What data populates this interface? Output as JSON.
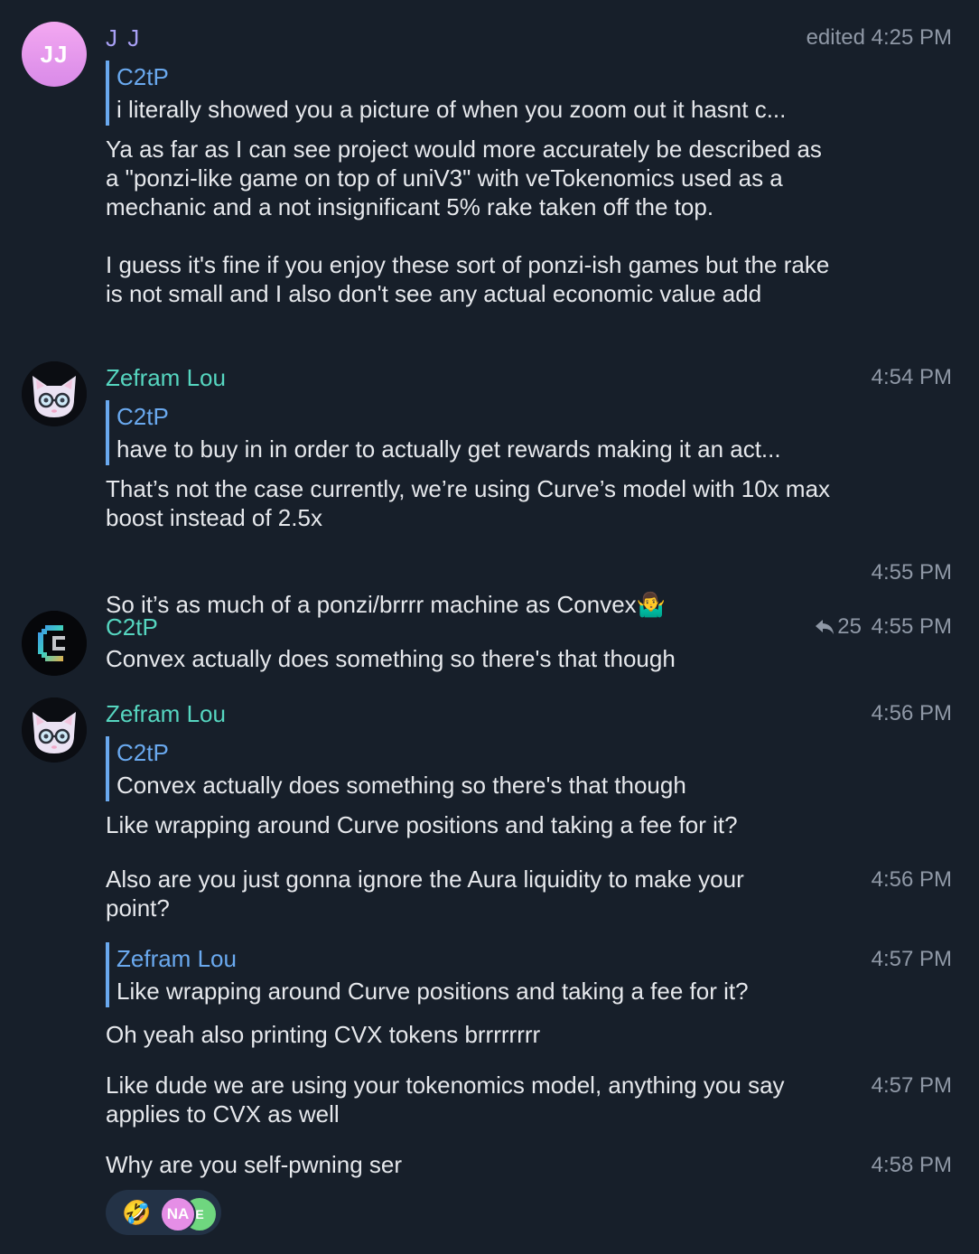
{
  "messages": {
    "m1": {
      "avatar_initials": "JJ",
      "sender": "J J",
      "time": "edited 4:25 PM",
      "reply_name": "C2tP",
      "reply_text": "i literally showed you a picture of when you zoom out it hasnt c...",
      "text": "Ya as far as I can see project would more accurately be described as a \"ponzi-like game on top of uniV3\" with veTokenomics used as a mechanic and a not insignificant 5% rake taken off the top.\n\nI guess it's fine if you enjoy these sort of ponzi-ish games but the rake is not small and I also don't see any actual economic value add"
    },
    "m2": {
      "sender": "Zefram Lou",
      "time": "4:54 PM",
      "reply_name": "C2tP",
      "reply_text": "have to buy in in order to actually get rewards making it an act...",
      "text": "That’s not the case currently, we’re using Curve’s model with 10x max boost instead of 2.5x"
    },
    "m3": {
      "text": "So it’s as much of a ponzi/brrrr machine as Convex",
      "emoji": "🤷‍♂️",
      "time": "4:55 PM"
    },
    "m4": {
      "sender": "C2tP",
      "reply_count": "25",
      "time": "4:55 PM",
      "text": "Convex actually does something so there's that though"
    },
    "m5": {
      "sender": "Zefram Lou",
      "time": "4:56 PM",
      "reply_name": "C2tP",
      "reply_text": "Convex actually does something so there's that though",
      "text": "Like wrapping around Curve positions and taking a fee for it?"
    },
    "m6": {
      "text": "Also are you just gonna ignore the Aura liquidity to make your point?",
      "time": "4:56 PM"
    },
    "m7": {
      "reply_name": "Zefram Lou",
      "reply_text": "Like wrapping around Curve positions and taking a fee for it?",
      "time": "4:57 PM",
      "text": "Oh yeah also printing CVX tokens brrrrrrrr"
    },
    "m8": {
      "text": "Like dude we are using your tokenomics model, anything you say applies to CVX as well",
      "time": "4:57 PM"
    },
    "m9": {
      "text": "Why are you self-pwning ser",
      "time": "4:58 PM",
      "reaction": {
        "emoji": "🤣",
        "avatar1_initials": "NA",
        "avatar1_color": "#e58ee6",
        "avatar2_initials": "E",
        "avatar2_color": "#6fd67f"
      }
    }
  },
  "colors": {
    "background": "#171f2a",
    "accent_blue": "#6aa9ef",
    "sender_teal": "#56d6c0",
    "sender_purple": "#a8a0f5",
    "meta_gray": "#8f98a6"
  }
}
